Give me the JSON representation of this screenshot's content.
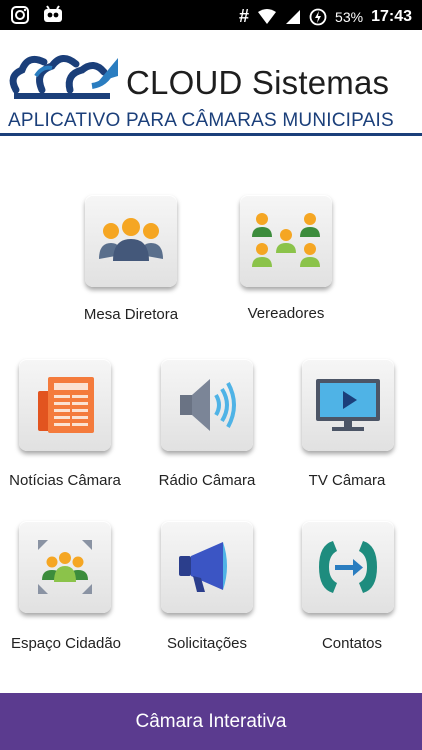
{
  "status_bar": {
    "battery": "53%",
    "time": "17:43"
  },
  "header": {
    "brand": "CLOUD Sistemas",
    "subtitle": "APLICATIVO PARA CÂMARAS MUNICIPAIS"
  },
  "menu": [
    {
      "label": "Mesa Diretora",
      "icon": "group-meeting-icon"
    },
    {
      "label": "Vereadores",
      "icon": "councilors-icon"
    },
    {
      "label": "Notícias Câmara",
      "icon": "newspaper-icon"
    },
    {
      "label": "Rádio Câmara",
      "icon": "speaker-icon"
    },
    {
      "label": "TV Câmara",
      "icon": "tv-icon"
    },
    {
      "label": "Espaço Cidadão",
      "icon": "citizen-space-icon"
    },
    {
      "label": "Solicitações",
      "icon": "megaphone-icon"
    },
    {
      "label": "Contatos",
      "icon": "phone-contacts-icon"
    }
  ],
  "footer": {
    "label": "Câmara Interativa"
  },
  "colors": {
    "brand_blue": "#1b3f7a",
    "footer_purple": "#5b3b8f"
  }
}
